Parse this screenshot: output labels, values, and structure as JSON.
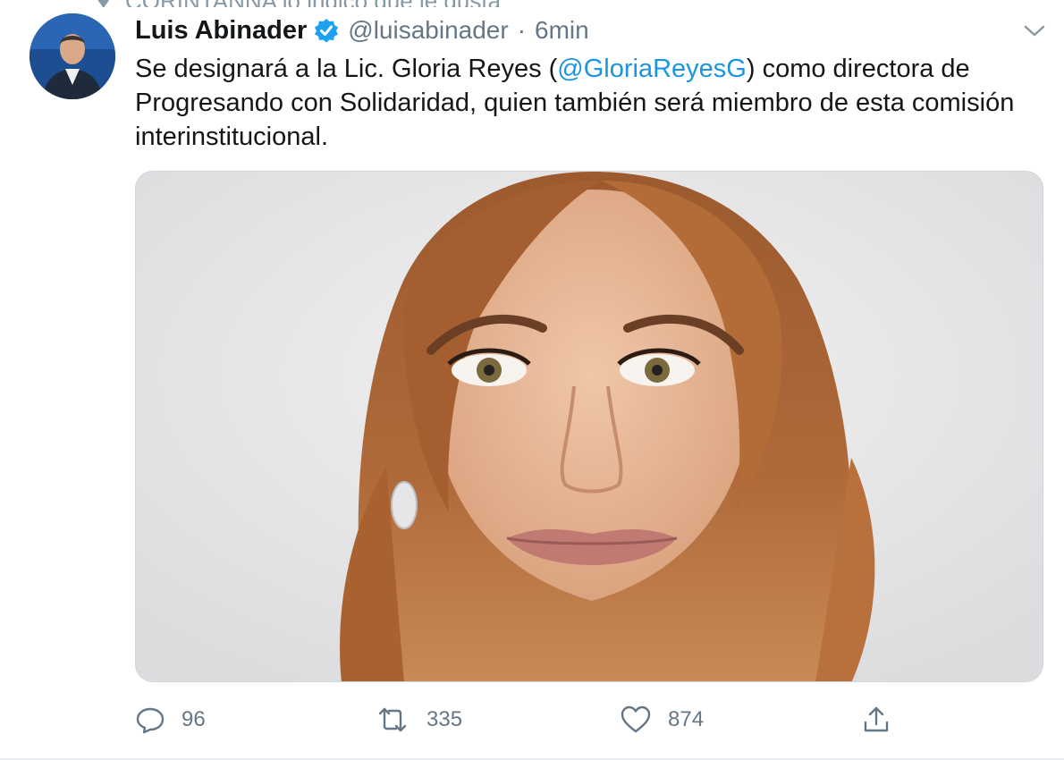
{
  "app": {
    "accent_color": "#1da1f2",
    "mention_color": "#1b95e0",
    "secondary_text_color": "#657786"
  },
  "context": {
    "text": "CORINTANNA lo indico que le gusta",
    "icon": "heart-icon"
  },
  "tweet": {
    "author_name": "Luis Abinader",
    "verified": true,
    "handle": "@luisabinader",
    "separator": "·",
    "timestamp": "6min",
    "text_before": "Se designará a la Lic. Gloria Reyes (",
    "mention": "@GloriaReyesG",
    "text_after": ") como directora de Progresando con Solidaridad, quien también será miembro de esta comisión interinstitucional.",
    "media": {
      "type": "photo",
      "alt": ""
    },
    "actions": {
      "reply": {
        "icon": "reply-icon",
        "count": "96"
      },
      "retweet": {
        "icon": "retweet-icon",
        "count": "335"
      },
      "like": {
        "icon": "heart-icon",
        "count": "874"
      },
      "share": {
        "icon": "share-icon"
      }
    },
    "menu_icon": "chevron-down-icon"
  }
}
